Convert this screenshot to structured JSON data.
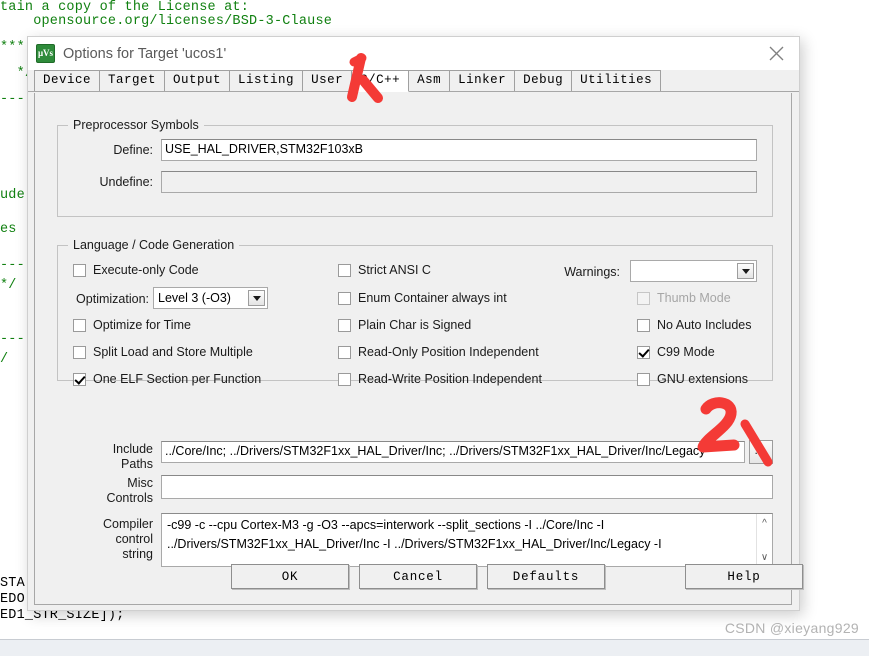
{
  "background": {
    "code_lines": [
      "tain a copy of the License at:",
      "    opensource.org/licenses/BSD-3-Clause",
      "***",
      "  */",
      "---",
      "ude",
      "es",
      "*/",
      "/",
      "STA",
      "EDO",
      "ED1_STR_SIZE]);"
    ],
    "watermark": "CSDN @xieyang929"
  },
  "dialog": {
    "title": "Options for Target 'ucos1'",
    "icon": "uvision-logo-icon",
    "close_icon": "close-icon",
    "tabs": [
      {
        "label": "Device",
        "active": false
      },
      {
        "label": "Target",
        "active": false
      },
      {
        "label": "Output",
        "active": false
      },
      {
        "label": "Listing",
        "active": false
      },
      {
        "label": "User",
        "active": false
      },
      {
        "label": "C/C++",
        "active": true
      },
      {
        "label": "Asm",
        "active": false
      },
      {
        "label": "Linker",
        "active": false
      },
      {
        "label": "Debug",
        "active": false
      },
      {
        "label": "Utilities",
        "active": false
      }
    ],
    "preprocessor": {
      "group_title": "Preprocessor Symbols",
      "define_label": "Define:",
      "define_value": "USE_HAL_DRIVER,STM32F103xB",
      "undefine_label": "Undefine:",
      "undefine_value": ""
    },
    "language": {
      "group_title": "Language / Code Generation",
      "col1": [
        {
          "label": "Execute-only Code",
          "checked": false,
          "disabled": false
        },
        {
          "label": "Optimize for Time",
          "checked": false,
          "disabled": false
        },
        {
          "label": "Split Load and Store Multiple",
          "checked": false,
          "disabled": false
        },
        {
          "label": "One ELF Section per Function",
          "checked": true,
          "disabled": false
        }
      ],
      "optimization_label": "Optimization:",
      "optimization_value": "Level 3 (-O3)",
      "col2": [
        {
          "label": "Strict ANSI C",
          "checked": false,
          "disabled": false
        },
        {
          "label": "Enum Container always int",
          "checked": false,
          "disabled": false
        },
        {
          "label": "Plain Char is Signed",
          "checked": false,
          "disabled": false
        },
        {
          "label": "Read-Only Position Independent",
          "checked": false,
          "disabled": false
        },
        {
          "label": "Read-Write Position Independent",
          "checked": false,
          "disabled": false
        }
      ],
      "warnings_label": "Warnings:",
      "warnings_value": "",
      "col3": [
        {
          "label": "Thumb Mode",
          "checked": false,
          "disabled": true
        },
        {
          "label": "No Auto Includes",
          "checked": false,
          "disabled": false
        },
        {
          "label": "C99 Mode",
          "checked": true,
          "disabled": false
        },
        {
          "label": "GNU extensions",
          "checked": false,
          "disabled": false
        }
      ]
    },
    "paths": {
      "include_label": "Include\nPaths",
      "include_value": "../Core/Inc;  ../Drivers/STM32F1xx_HAL_Driver/Inc;  ../Drivers/STM32F1xx_HAL_Driver/Inc/Legacy",
      "browse_label": "...",
      "misc_label": "Misc\nControls",
      "misc_value": "",
      "compiler_label": "Compiler\ncontrol\nstring",
      "compiler_value": "-c99 -c --cpu Cortex-M3 -g -O3 --apcs=interwork --split_sections -I ../Core/Inc -I\n../Drivers/STM32F1xx_HAL_Driver/Inc -I ../Drivers/STM32F1xx_HAL_Driver/Inc/Legacy -I",
      "scroll_up_icon": "chevron-up-icon",
      "scroll_down_icon": "chevron-down-icon"
    },
    "buttons": [
      {
        "label": "OK"
      },
      {
        "label": "Cancel"
      },
      {
        "label": "Defaults"
      },
      {
        "label": "Help"
      }
    ]
  },
  "annotations": {
    "color": "#f43a36",
    "marker_1": "1",
    "marker_2": "2"
  }
}
